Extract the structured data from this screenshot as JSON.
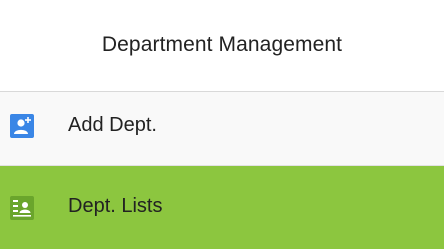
{
  "header": {
    "title": "Department Management"
  },
  "menu": {
    "items": [
      {
        "label": "Add Dept.",
        "icon": "add-department-icon",
        "icon_color": "#3a86e6",
        "selected": false
      },
      {
        "label": "Dept. Lists",
        "icon": "department-list-icon",
        "icon_color": "#6aa52c",
        "selected": true
      }
    ]
  },
  "colors": {
    "selected_bg": "#8cc63f",
    "header_bg": "#ffffff",
    "item_bg": "#f9f9f9"
  }
}
